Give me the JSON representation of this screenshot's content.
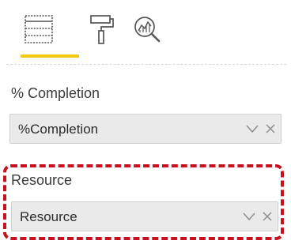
{
  "toolbar": {
    "tabs": [
      {
        "icon": "fields-icon"
      },
      {
        "icon": "format-paint-roller-icon"
      },
      {
        "icon": "analytics-magnifier-icon"
      }
    ],
    "accent_color": "#f2c811"
  },
  "fields": [
    {
      "label": "% Completion",
      "value": "%Completion"
    },
    {
      "label": "Resource",
      "value": "Resource"
    }
  ],
  "highlight_color": "#c8101e"
}
